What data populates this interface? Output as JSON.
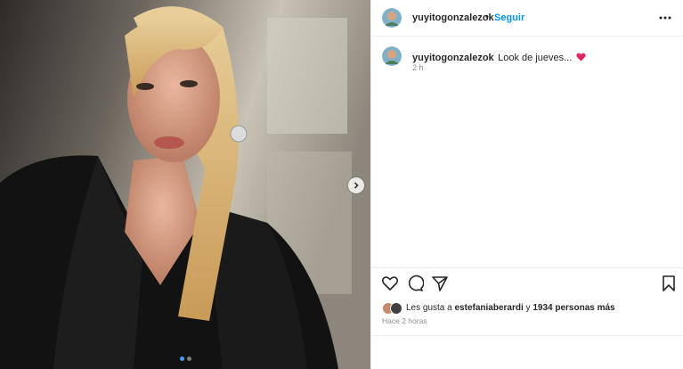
{
  "post": {
    "username": "yuyitogonzalezok",
    "follow_label": "Seguir",
    "separator": "•",
    "caption": "Look de jueves...",
    "caption_emoji": "heart-emoji",
    "posted_ago": "2 h"
  },
  "likes": {
    "prefix": "Les gusta a",
    "user": "estefaniaberardi",
    "conj": "y",
    "others": "1934 personas más"
  },
  "timestamp": "Hace 2 horas",
  "carousel": {
    "count": 2,
    "active_index": 0
  },
  "icons": {
    "more": "more-horizontal-icon",
    "like": "heart-icon",
    "comment": "comment-icon",
    "share": "send-icon",
    "save": "bookmark-icon",
    "next": "chevron-right-icon"
  },
  "colors": {
    "accent": "#0095f6",
    "text": "#262626",
    "muted": "#8e8e8e",
    "heart": "#e0245e"
  }
}
